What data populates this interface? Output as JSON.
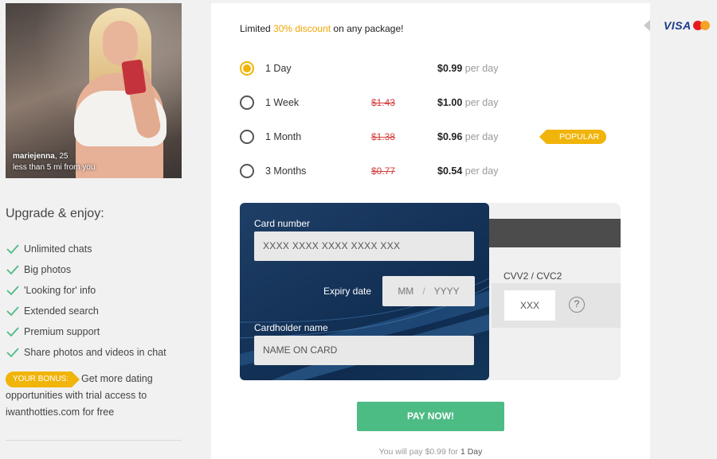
{
  "profile": {
    "name": "mariejenna",
    "age": ", 25",
    "distance": "less than 5 mi from you"
  },
  "upgrade": {
    "title": "Upgrade & enjoy:",
    "features": [
      "Unlimited chats",
      "Big photos",
      "'Looking for' info",
      "Extended search",
      "Premium support",
      "Share photos and videos in chat"
    ]
  },
  "bonus": {
    "badge": "YOUR BONUS:",
    "text": "Get more dating opportunities with trial access to iwanthotties.com for free"
  },
  "offer": {
    "prefix": "Limited ",
    "highlight": "30% discount",
    "suffix": " on any package!"
  },
  "packages": [
    {
      "name": "1 Day",
      "old_price": "",
      "price": "$0.99",
      "per": "per day",
      "selected": true,
      "badge": ""
    },
    {
      "name": "1 Week",
      "old_price": "$1.43",
      "price": "$1.00",
      "per": "per day",
      "selected": false,
      "badge": ""
    },
    {
      "name": "1 Month",
      "old_price": "$1.38",
      "price": "$0.96",
      "per": "per day",
      "selected": false,
      "badge": "POPULAR"
    },
    {
      "name": "3 Months",
      "old_price": "$0.77",
      "price": "$0.54",
      "per": "per day",
      "selected": false,
      "badge": ""
    }
  ],
  "card": {
    "number_label": "Card number",
    "number_placeholder": "XXXX XXXX XXXX XXXX XXX",
    "expiry_label": "Expiry date",
    "expiry_month_placeholder": "MM",
    "expiry_separator": "/",
    "expiry_year_placeholder": "YYYY",
    "holder_label": "Cardholder name",
    "holder_placeholder": "NAME ON CARD",
    "cvv_label": "CVV2 / CVC2",
    "cvv_placeholder": "XXX",
    "help_symbol": "?"
  },
  "pay": {
    "button_label": "PAY NOW!",
    "summary_prefix": "You will pay ",
    "summary_amount": "$0.99",
    "summary_middle": " for ",
    "summary_period": "1 Day"
  },
  "brands": {
    "visa_label": "VISA",
    "mastercard_icon": "mastercard-icon"
  },
  "colors": {
    "accent": "#f0b40a",
    "pay_button": "#4dbb84",
    "old_price": "#d43c3c",
    "card_blue": "#16345a"
  }
}
